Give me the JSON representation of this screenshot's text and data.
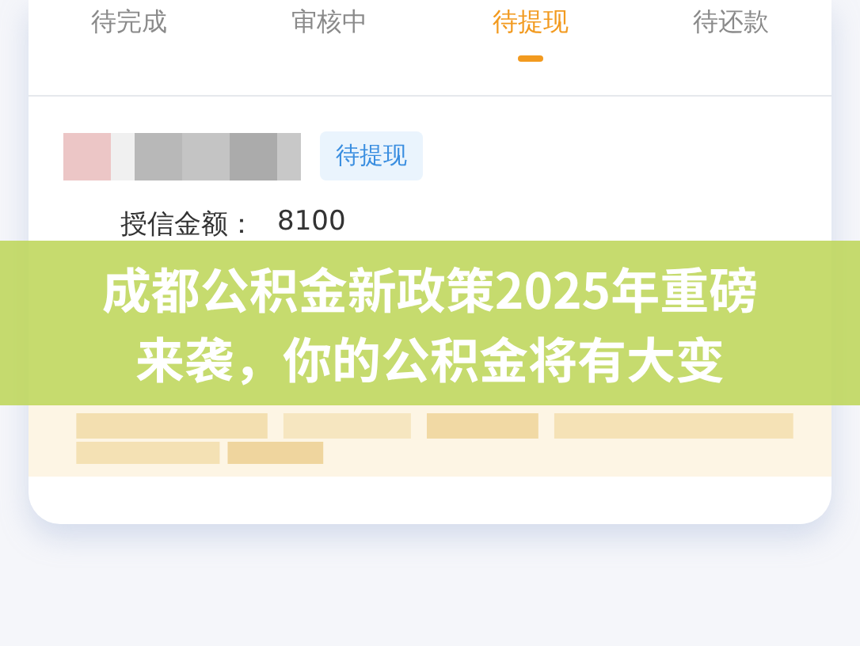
{
  "tabs": [
    {
      "label": "待完成",
      "selected": false
    },
    {
      "label": "审核中",
      "selected": false
    },
    {
      "label": "待提现",
      "selected": true
    },
    {
      "label": "待还款",
      "selected": false
    }
  ],
  "order": {
    "status": "待提现",
    "credit_label": "授信金额：",
    "credit_value": "8100"
  },
  "banner": {
    "title": "成都公积金新政策2025年重磅来袭，你的公积金将有大变"
  }
}
